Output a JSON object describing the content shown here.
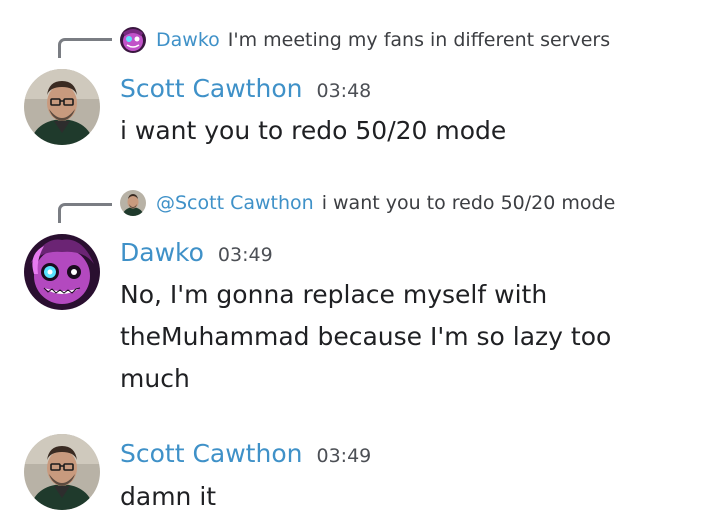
{
  "messages": [
    {
      "reply": {
        "author": "Dawko",
        "text": "I'm meeting my fans in different servers"
      },
      "author": "Scott Cawthon",
      "time": "03:48",
      "content": "i want you to redo 50/20 mode"
    },
    {
      "reply": {
        "author": "@Scott Cawthon",
        "text": "i want you to redo 50/20 mode"
      },
      "author": "Dawko",
      "time": "03:49",
      "content": "No, I'm gonna replace myself with theMuhammad because I'm so lazy too much"
    },
    {
      "author": "Scott Cawthon",
      "time": "03:49",
      "content": "damn it"
    }
  ],
  "colors": {
    "author": "#3f91c8",
    "text": "#1f2023",
    "timestamp": "#4c4f55",
    "reply_line": "#7a7d83"
  },
  "icons": {
    "scott_avatar": "scott-cawthon-avatar",
    "dawko_avatar": "dawko-avatar"
  }
}
